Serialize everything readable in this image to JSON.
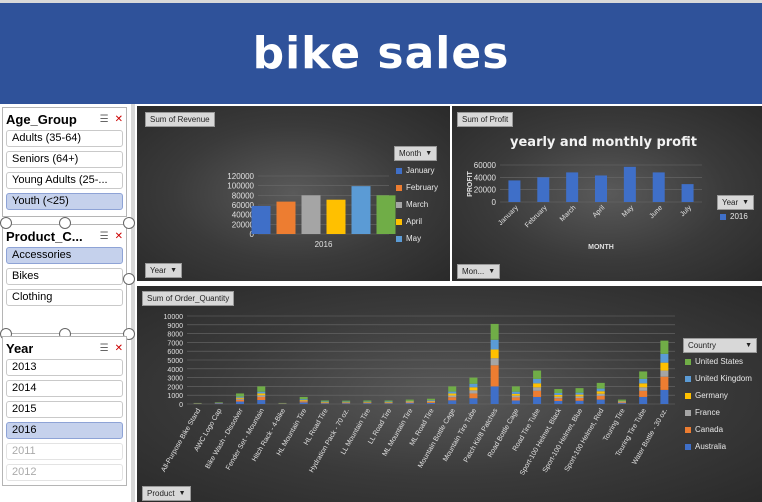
{
  "header": {
    "title": "bike sales"
  },
  "slicers": {
    "age": {
      "title": "Age_Group",
      "items": [
        {
          "label": "Adults (35-64)",
          "state": "normal"
        },
        {
          "label": "Seniors (64+)",
          "state": "normal"
        },
        {
          "label": "Young Adults (25-...",
          "state": "normal"
        },
        {
          "label": "Youth (<25)",
          "state": "selected"
        }
      ]
    },
    "product": {
      "title": "Product_C...",
      "items": [
        {
          "label": "Accessories",
          "state": "selected"
        },
        {
          "label": "Bikes",
          "state": "normal"
        },
        {
          "label": "Clothing",
          "state": "normal"
        }
      ]
    },
    "year": {
      "title": "Year",
      "items": [
        {
          "label": "2013",
          "state": "normal"
        },
        {
          "label": "2014",
          "state": "normal"
        },
        {
          "label": "2015",
          "state": "normal"
        },
        {
          "label": "2016",
          "state": "selected"
        },
        {
          "label": "2011",
          "state": "dim"
        },
        {
          "label": "2012",
          "state": "dim"
        }
      ]
    }
  },
  "chart_data": [
    {
      "type": "bar",
      "title": "",
      "field_button": "Sum of Revenue",
      "filter_button": "Year",
      "legend_button": "Month",
      "categories": [
        "2016"
      ],
      "series": [
        {
          "name": "January",
          "values": [
            58000
          ],
          "color": "#3f6fc8"
        },
        {
          "name": "February",
          "values": [
            67000
          ],
          "color": "#ed7d31"
        },
        {
          "name": "March",
          "values": [
            80000
          ],
          "color": "#a5a5a5"
        },
        {
          "name": "April",
          "values": [
            71000
          ],
          "color": "#ffc000"
        },
        {
          "name": "May",
          "values": [
            99000
          ],
          "color": "#5b9bd5"
        },
        {
          "name": "",
          "values": [
            80000
          ],
          "color": "#70ad47"
        }
      ],
      "yticks": [
        "0",
        "20000",
        "40000",
        "60000",
        "80000",
        "100000",
        "120000"
      ],
      "ylim": [
        0,
        120000
      ]
    },
    {
      "type": "bar",
      "title": "yearly and monthly profit",
      "field_button": "Sum of Profit",
      "filter_button": "Mon...",
      "legend_button": "Year",
      "xlabel": "MONTH",
      "ylabel": "PROFIT",
      "categories": [
        "January",
        "February",
        "March",
        "April",
        "May",
        "June",
        "July"
      ],
      "series": [
        {
          "name": "2016",
          "values": [
            35000,
            40000,
            48000,
            43000,
            57000,
            48000,
            29000
          ],
          "color": "#3f6fc8"
        }
      ],
      "yticks": [
        "0",
        "20000",
        "40000",
        "60000"
      ],
      "ylim": [
        0,
        60000
      ]
    },
    {
      "type": "bar",
      "stacked": true,
      "title": "",
      "field_button": "Sum of Order_Quantity",
      "filter_button": "Product",
      "legend_button": "Country",
      "categories": [
        "All-Purpose Bike Stand",
        "AWC Logo Cap",
        "Bike Wash - Dissolver",
        "Fender Set - Mountain",
        "Hitch Rack - 4-Bike",
        "HL Mountain Tire",
        "HL Road Tire",
        "Hydration Pack - 70 oz.",
        "LL Mountain Tire",
        "LL Road Tire",
        "ML Mountain Tire",
        "ML Road Tire",
        "Mountain Bottle Cage",
        "Mountain Tire Tube",
        "Patch Kit/8 Patches",
        "Road Bottle Cage",
        "Road Tire Tube",
        "Sport-100 Helmet, Black",
        "Sport-100 Helmet, Blue",
        "Sport-100 Helmet, Red",
        "Touring Tire",
        "Touring Tire Tube",
        "Water Bottle - 30 oz."
      ],
      "series": [
        {
          "name": "Australia",
          "values": [
            30,
            60,
            280,
            450,
            30,
            180,
            80,
            80,
            90,
            80,
            100,
            130,
            420,
            650,
            2000,
            400,
            800,
            350,
            370,
            500,
            100,
            800,
            1600
          ],
          "color": "#3f6fc8"
        },
        {
          "name": "Canada",
          "values": [
            20,
            30,
            200,
            350,
            20,
            120,
            60,
            60,
            60,
            60,
            80,
            100,
            350,
            550,
            2400,
            350,
            700,
            300,
            310,
            420,
            80,
            700,
            1500
          ],
          "color": "#ed7d31"
        },
        {
          "name": "France",
          "values": [
            10,
            20,
            120,
            200,
            10,
            80,
            40,
            40,
            40,
            40,
            50,
            60,
            200,
            350,
            800,
            200,
            400,
            180,
            190,
            250,
            50,
            400,
            700
          ],
          "color": "#a5a5a5"
        },
        {
          "name": "Germany",
          "values": [
            10,
            20,
            120,
            200,
            10,
            80,
            50,
            40,
            40,
            50,
            60,
            70,
            220,
            350,
            1000,
            200,
            450,
            200,
            200,
            280,
            60,
            450,
            900
          ],
          "color": "#ffc000"
        },
        {
          "name": "United Kingdom",
          "values": [
            10,
            20,
            120,
            200,
            10,
            90,
            50,
            50,
            40,
            50,
            60,
            80,
            220,
            400,
            1100,
            250,
            500,
            220,
            220,
            300,
            60,
            500,
            1000
          ],
          "color": "#5b9bd5"
        },
        {
          "name": "United States",
          "values": [
            40,
            50,
            360,
            600,
            40,
            250,
            120,
            110,
            130,
            120,
            150,
            160,
            590,
            700,
            1800,
            600,
            950,
            450,
            510,
            650,
            150,
            850,
            1500
          ],
          "color": "#70ad47"
        }
      ],
      "yticks": [
        "0",
        "1000",
        "2000",
        "3000",
        "4000",
        "5000",
        "6000",
        "7000",
        "8000",
        "9000",
        "10000"
      ],
      "ylim": [
        0,
        10000
      ]
    }
  ]
}
